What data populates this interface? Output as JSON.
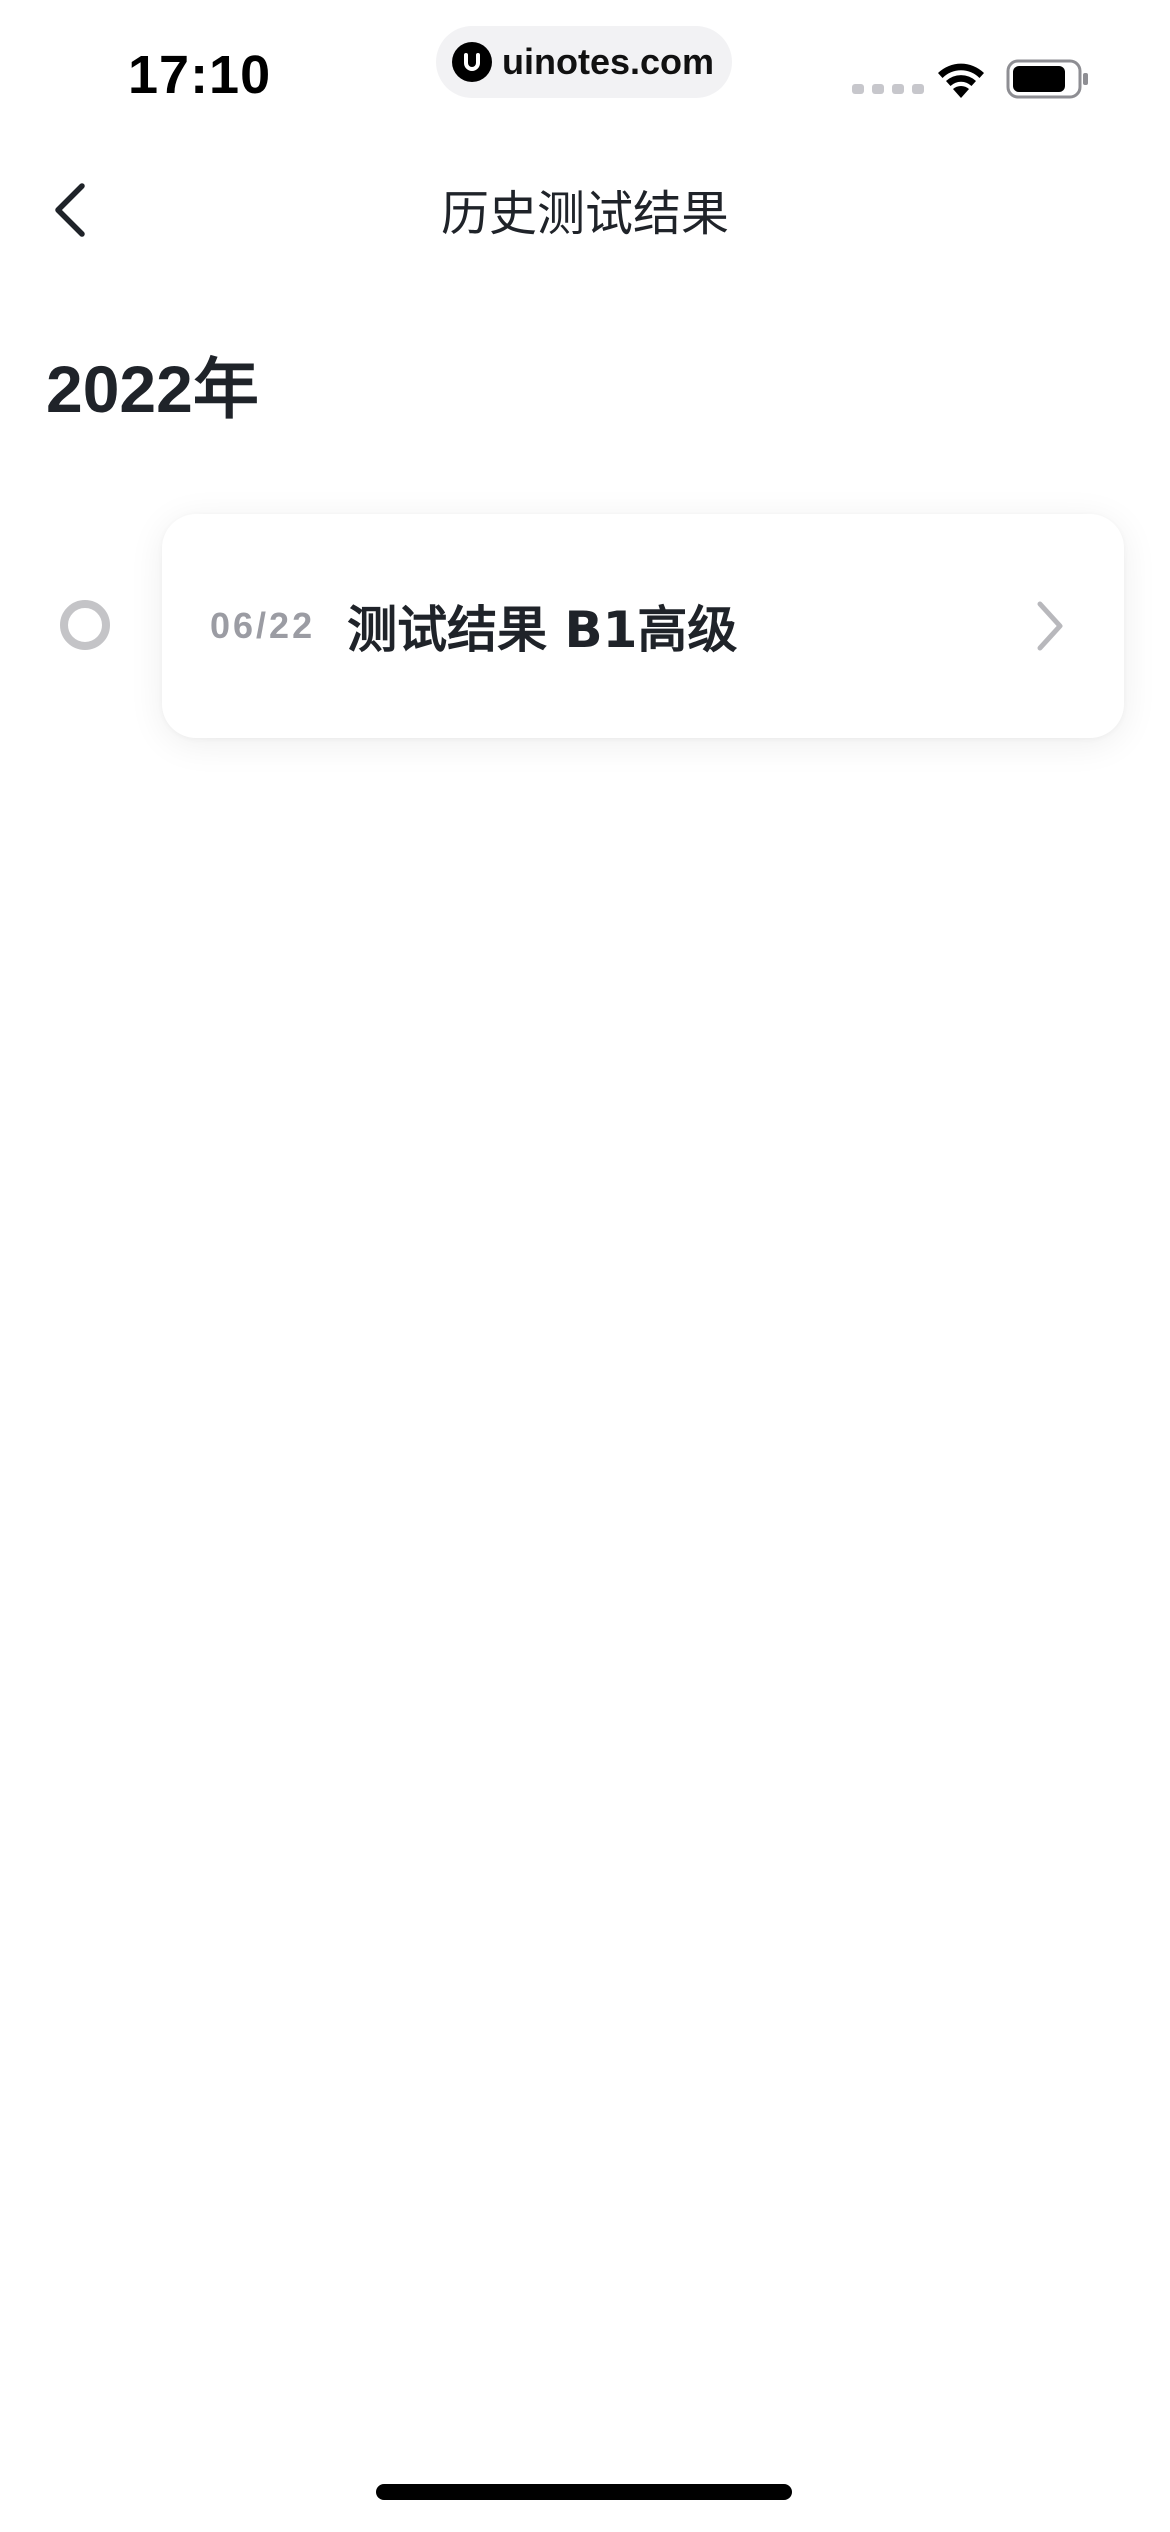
{
  "status_bar": {
    "time": "17:10",
    "url": "uinotes.com",
    "icons": [
      "signal-icon",
      "wifi-icon",
      "battery-icon"
    ]
  },
  "nav": {
    "title": "历史测试结果",
    "back_icon": "chevron-left-icon"
  },
  "year_heading": "2022年",
  "results": [
    {
      "date": "06/22",
      "title": "测试结果 B1高级",
      "icon": "chevron-right-icon"
    }
  ],
  "colors": {
    "text_primary": "#1f2329",
    "text_secondary": "#9b9ca3",
    "timeline_dot": "#c4c4c7",
    "chevron": "#b8b8bc"
  }
}
